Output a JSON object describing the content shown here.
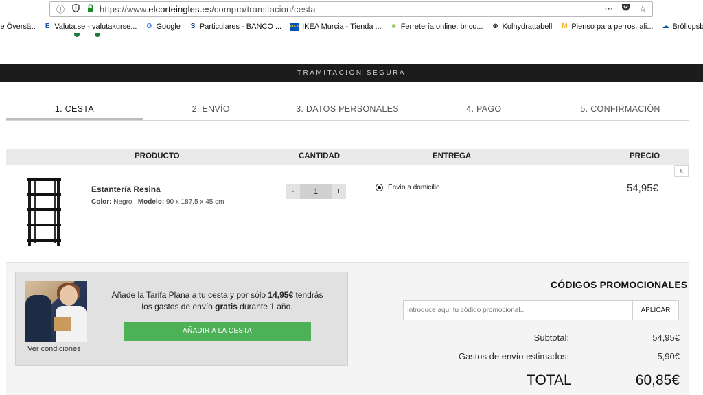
{
  "browser": {
    "url_scheme": "https://www.",
    "url_host": "elcorteingles.es",
    "url_path": "/compra/tramitacion/cesta",
    "more_icon": "⋯",
    "pocket_icon": "pocket-icon",
    "star_icon": "☆"
  },
  "bookmarks": [
    {
      "label": "le Översätt",
      "icon": "",
      "color": "#ffffff"
    },
    {
      "label": "Valuta.se - valutakurse...",
      "icon": "E",
      "color": "#1a56a6"
    },
    {
      "label": "Google",
      "icon": "G",
      "color": "#4285f4"
    },
    {
      "label": "Particulares - BANCO ...",
      "icon": "S",
      "color": "#0a3c7a"
    },
    {
      "label": "IKEA Murcia - Tienda ...",
      "icon": "IKEA",
      "color": "#0051ba"
    },
    {
      "label": "Ferretería online: brico...",
      "icon": "■",
      "color": "#8bc34a"
    },
    {
      "label": "Kolhydrattabell",
      "icon": "⊕",
      "color": "#222222"
    },
    {
      "label": "Pienso para perros, ali...",
      "icon": "M",
      "color": "#f2b21c"
    },
    {
      "label": "Bröllopsbilder – OneD...",
      "icon": "☁",
      "color": "#0a4ea2"
    }
  ],
  "secure_banner": "TRAMITACIÓN SEGURA",
  "steps": [
    {
      "label": "1. CESTA",
      "active": true
    },
    {
      "label": "2. ENVÍO",
      "active": false
    },
    {
      "label": "3. DATOS PERSONALES",
      "active": false
    },
    {
      "label": "4. PAGO",
      "active": false
    },
    {
      "label": "5. CONFIRMACIÓN",
      "active": false
    }
  ],
  "cart": {
    "headers": {
      "product": "PRODUCTO",
      "quantity": "CANTIDAD",
      "delivery": "ENTREGA",
      "price": "PRECIO"
    },
    "remove_label": "x",
    "item": {
      "name": "Estantería Resina",
      "color_label": "Color:",
      "color_value": "Negro",
      "model_label": "Modelo:",
      "model_value": "90 x 187,5 x 45 cm",
      "quantity": "1",
      "minus": "-",
      "plus": "+",
      "delivery_option": "Envío a domicilio",
      "price": "54,95€"
    }
  },
  "tarifa": {
    "text_pre": "Añade la Tarifa Plana a tu cesta y por sólo ",
    "text_price": "14,95€",
    "text_mid": " tendrás",
    "text_line2_pre": "los gastos de envío ",
    "text_gratis": "gratis",
    "text_line2_post": " durante 1 año.",
    "button": "AÑADIR A LA CESTA",
    "conditions_link": "Ver condiciones"
  },
  "promo": {
    "title": "CÓDIGOS PROMOCIONALES",
    "placeholder": "Introduce aquí tu código promocional...",
    "apply": "APLICAR"
  },
  "summary": {
    "subtotal_label": "Subtotal:",
    "subtotal_value": "54,95€",
    "shipping_label": "Gastos de envío estimados:",
    "shipping_value": "5,90€",
    "total_label": "TOTAL",
    "total_value": "60,85€"
  }
}
